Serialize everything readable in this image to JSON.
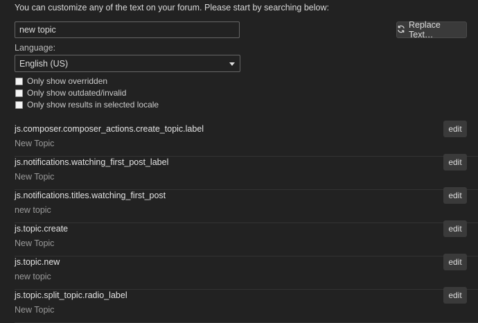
{
  "intro_text": "You can customize any of the text on your forum. Please start by searching below:",
  "search": {
    "value": "new topic"
  },
  "replace_button": {
    "label": "Replace Text…",
    "icon": "refresh-icon"
  },
  "language": {
    "label": "Language:",
    "selected": "English (US)"
  },
  "filters": [
    {
      "label": "Only show overridden",
      "checked": false
    },
    {
      "label": "Only show outdated/invalid",
      "checked": false
    },
    {
      "label": "Only show results in selected locale",
      "checked": false
    }
  ],
  "results": [
    {
      "key": "js.composer.composer_actions.create_topic.label",
      "value": "New Topic",
      "edit": "edit"
    },
    {
      "key": "js.notifications.watching_first_post_label",
      "value": "New Topic",
      "edit": "edit"
    },
    {
      "key": "js.notifications.titles.watching_first_post",
      "value": "new topic",
      "edit": "edit"
    },
    {
      "key": "js.topic.create",
      "value": "New Topic",
      "edit": "edit"
    },
    {
      "key": "js.topic.new",
      "value": "new topic",
      "edit": "edit"
    },
    {
      "key": "js.topic.split_topic.radio_label",
      "value": "New Topic",
      "edit": "edit"
    }
  ]
}
